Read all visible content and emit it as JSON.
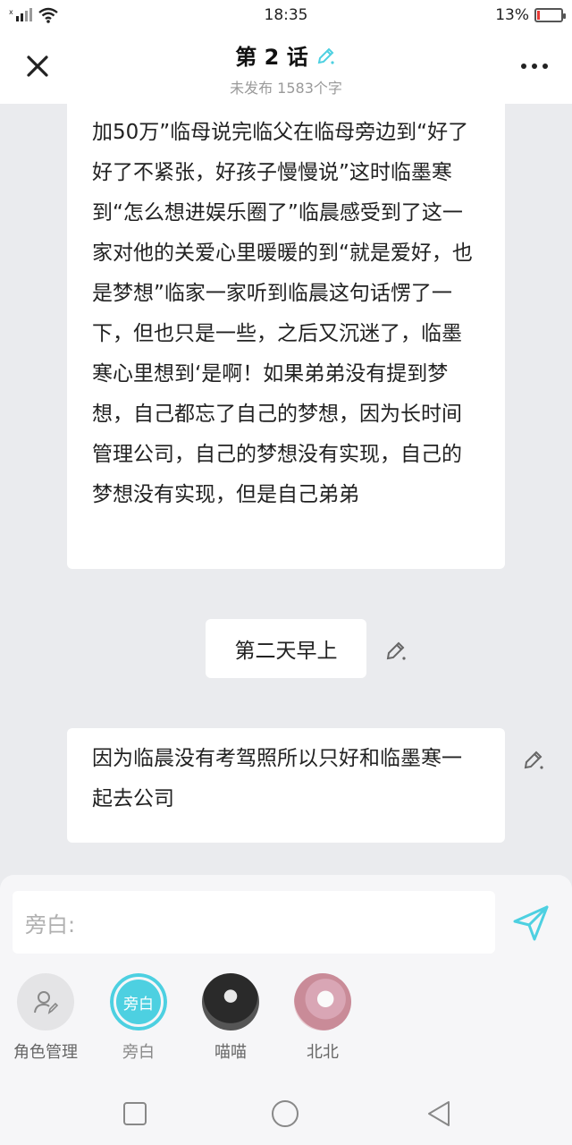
{
  "status": {
    "time": "18:35",
    "battery": "13%",
    "battery_level": 0.13,
    "left_icons": [
      "signal-icon",
      "wifi-icon"
    ]
  },
  "header": {
    "title": "第 2 话",
    "subtitle": "未发布 1583个字",
    "accent": "#4dd0e1"
  },
  "messages": [
    {
      "type": "narration",
      "text": "加50万”临母说完临父在临母旁边到“好了好了不紧张，好孩子慢慢说”这时临墨寒到“怎么想进娱乐圈了”临晨感受到了这一家对他的关爱心里暖暖的到“就是爱好，也是梦想”临家一家听到临晨这句话愣了一下，但也只是一些，之后又沉迷了，临墨寒心里想到‘是啊！如果弟弟没有提到梦想，自己都忘了自己的梦想，因为长时间管理公司，自己的梦想没有实现，自己的梦想没有实现，但是自己弟弟"
    },
    {
      "type": "scene",
      "text": "第二天早上"
    },
    {
      "type": "narration",
      "text": "因为临晨没有考驾照所以只好和临墨寒一起去公司"
    }
  ],
  "composer": {
    "placeholder": "旁白:"
  },
  "roles": [
    {
      "label": "角色管理",
      "icon": "role-manage-icon"
    },
    {
      "label": "旁白",
      "badge": "旁白",
      "selected": true
    },
    {
      "label": "喵喵",
      "icon": "avatar"
    },
    {
      "label": "北北",
      "icon": "avatar"
    }
  ],
  "nav": [
    "recent-apps-icon",
    "home-icon",
    "back-icon"
  ]
}
